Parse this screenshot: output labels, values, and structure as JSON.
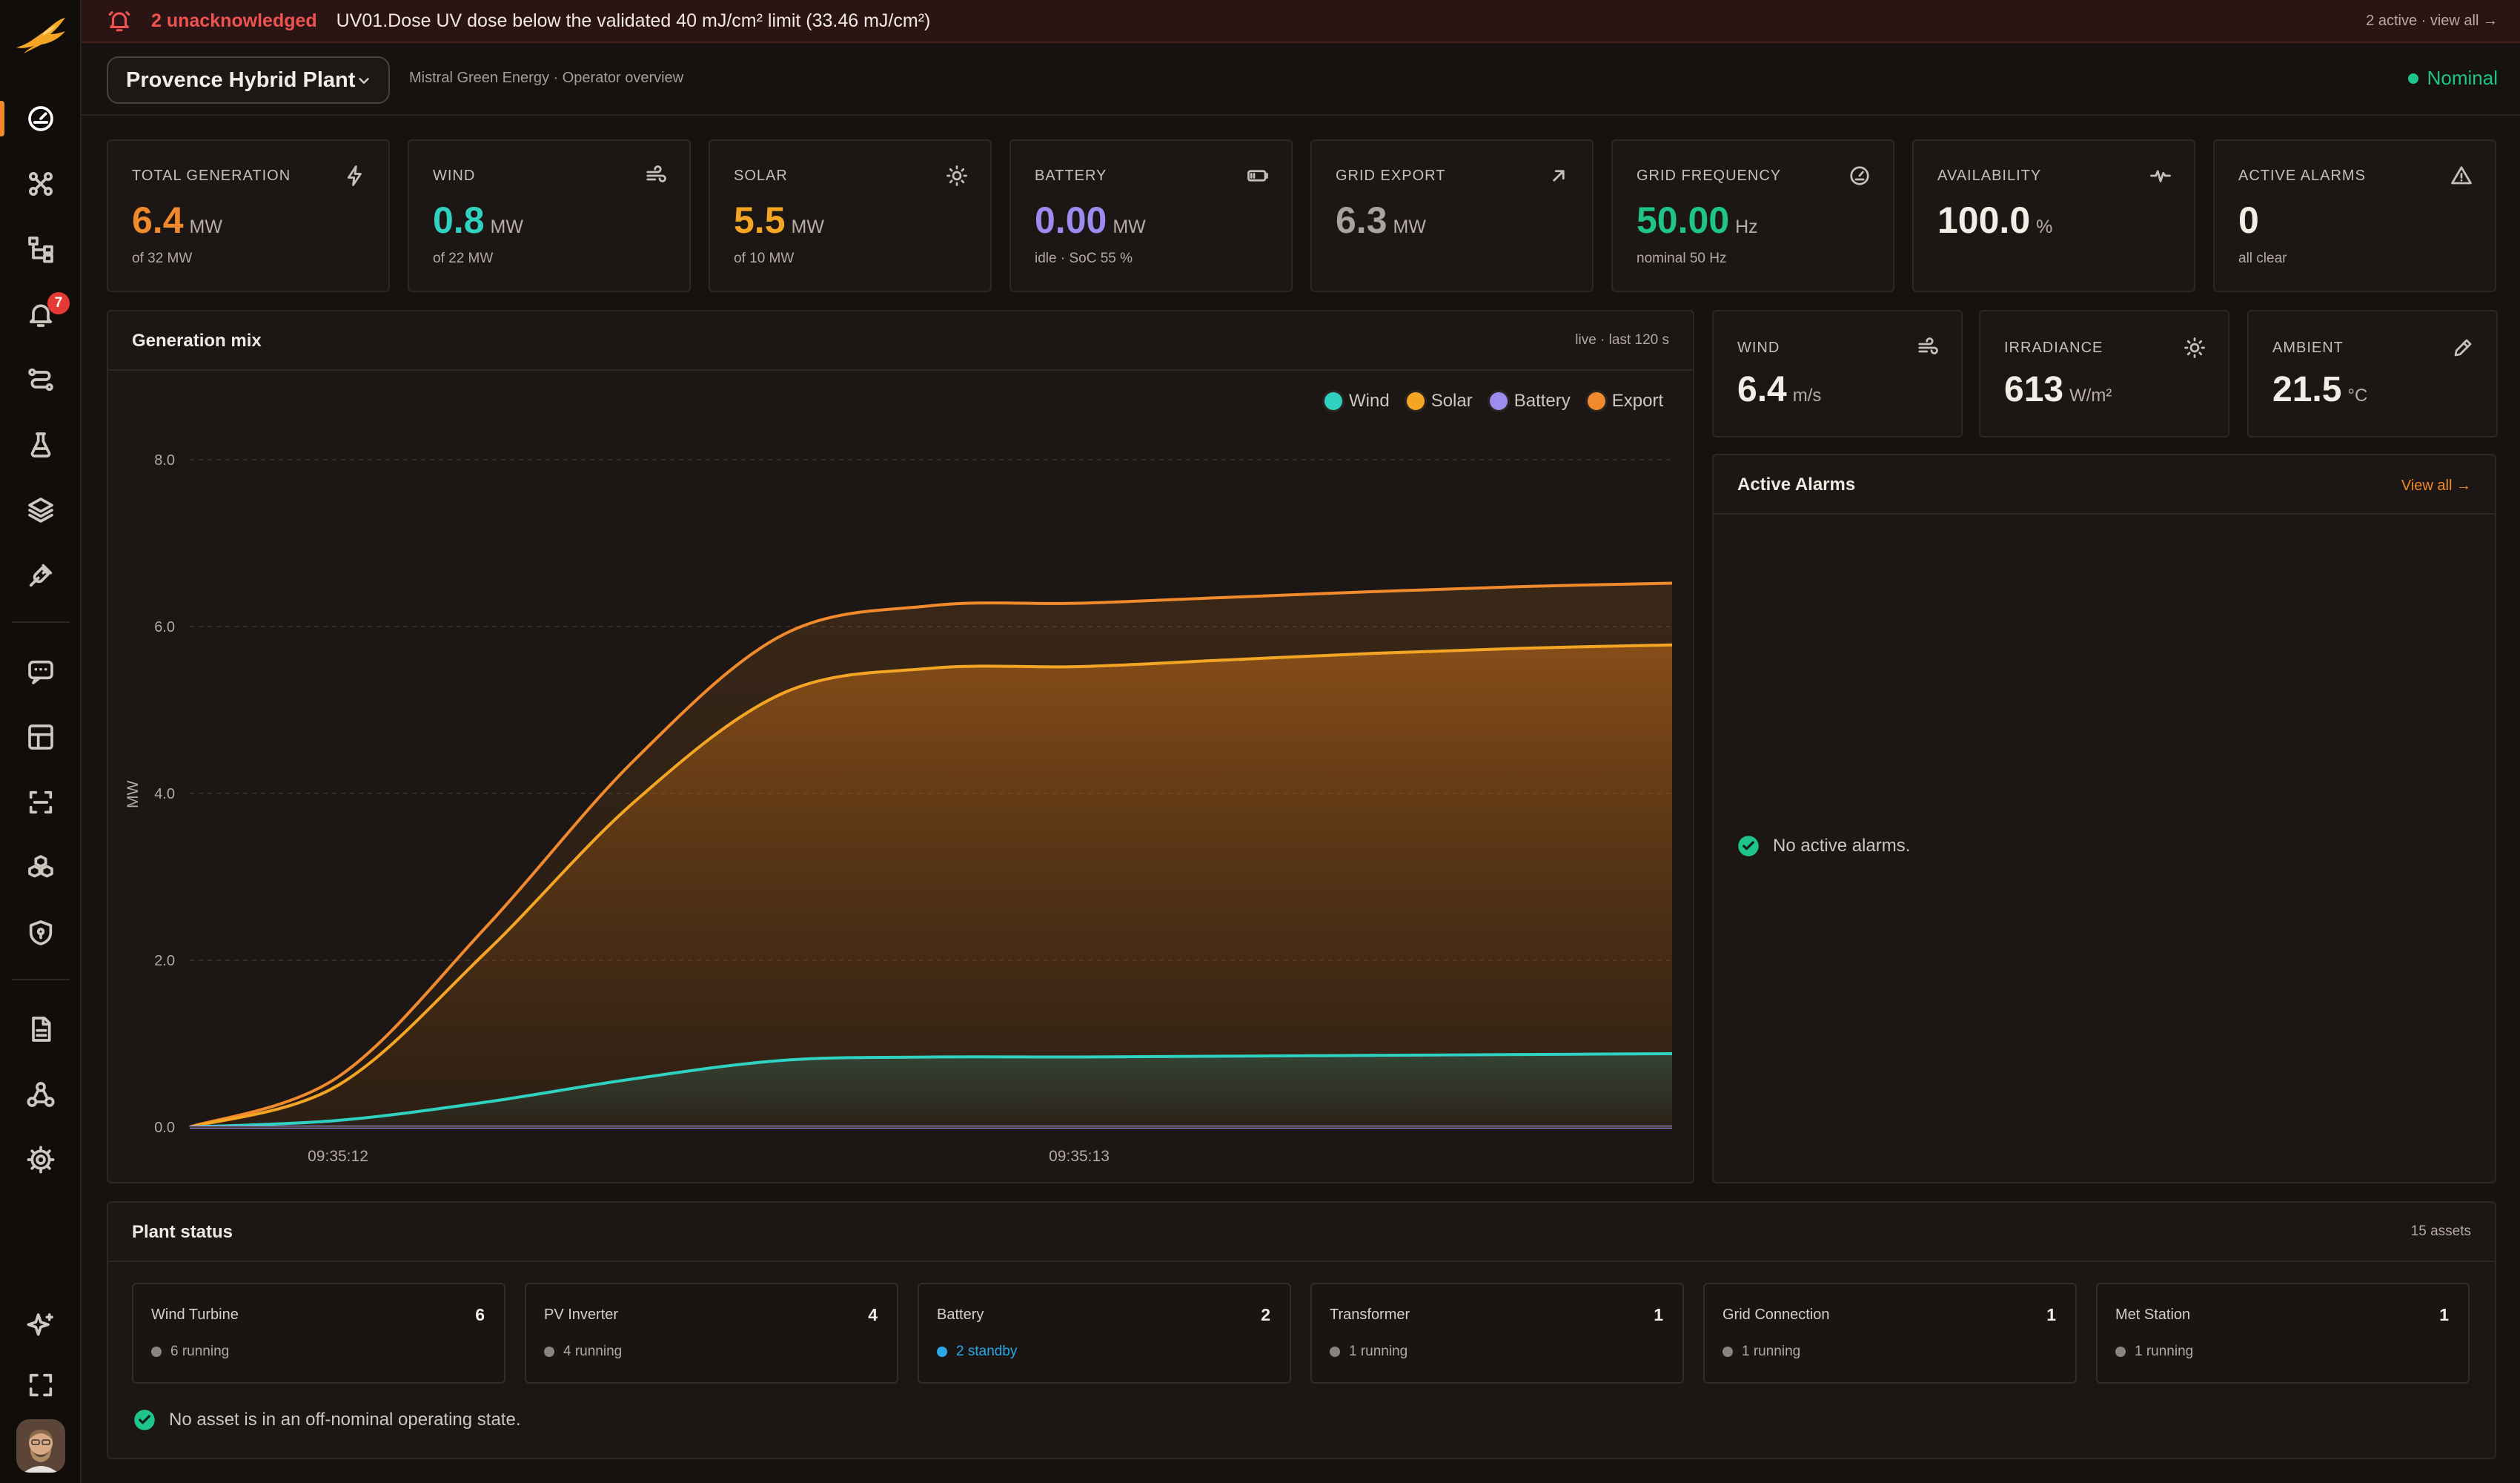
{
  "alert_bar": {
    "count_text": "2 unacknowledged",
    "message": "UV01.Dose UV dose below the validated 40 mJ/cm² limit (33.46 mJ/cm²)",
    "link": "2 active · view all →"
  },
  "sidebar": {
    "notification_badge": "7",
    "items": [
      "dashboard-icon",
      "network-icon",
      "hierarchy-icon",
      "bell-icon",
      "route-icon",
      "flask-icon",
      "layers-icon",
      "plug-icon",
      "chat-icon",
      "grid-icon",
      "scan-icon",
      "modules-icon",
      "shield-icon",
      "document-icon",
      "org-icon",
      "settings-icon",
      "sparkle-icon",
      "fullscreen-icon"
    ]
  },
  "header": {
    "plant_name": "Provence Hybrid Plant",
    "subtitle": "Mistral Green Energy · Operator overview",
    "status": "Nominal"
  },
  "kpis": [
    {
      "label": "TOTAL GENERATION",
      "value": "6.4",
      "unit": "MW",
      "sub": "of 32 MW",
      "color": "#f08a2c",
      "icon": "bolt-icon"
    },
    {
      "label": "WIND",
      "value": "0.8",
      "unit": "MW",
      "sub": "of 22 MW",
      "color": "#2fd1c0",
      "icon": "wind-icon"
    },
    {
      "label": "SOLAR",
      "value": "5.5",
      "unit": "MW",
      "sub": "of 10 MW",
      "color": "#f5a524",
      "icon": "sun-icon"
    },
    {
      "label": "BATTERY",
      "value": "0.00",
      "unit": "MW",
      "sub": "idle · SoC 55 %",
      "color": "#9d8cf0",
      "icon": "battery-icon"
    },
    {
      "label": "GRID EXPORT",
      "value": "6.3",
      "unit": "MW",
      "sub": "",
      "color": "#a8a2a0",
      "icon": "arrow-up-right-icon"
    },
    {
      "label": "GRID FREQUENCY",
      "value": "50.00",
      "unit": "Hz",
      "sub": "nominal 50 Hz",
      "color": "#1fc48a",
      "icon": "gauge-icon"
    },
    {
      "label": "AVAILABILITY",
      "value": "100.0",
      "unit": "%",
      "sub": "",
      "color": "#f3ede6",
      "icon": "pulse-icon"
    },
    {
      "label": "ACTIVE ALARMS",
      "value": "0",
      "unit": "",
      "sub": "all clear",
      "color": "#f3ede6",
      "icon": "warning-icon"
    }
  ],
  "generation_mix": {
    "title": "Generation mix",
    "live_label": "live · last 120 s"
  },
  "environment": [
    {
      "label": "WIND",
      "value": "6.4",
      "unit": "m/s",
      "icon": "wind-icon"
    },
    {
      "label": "IRRADIANCE",
      "value": "613",
      "unit": "W/m²",
      "icon": "sun-icon"
    },
    {
      "label": "AMBIENT",
      "value": "21.5",
      "unit": "°C",
      "icon": "thermometer-icon"
    }
  ],
  "alarms_panel": {
    "title": "Active Alarms",
    "view_all": "View all →",
    "empty_text": "No active alarms."
  },
  "plant_status": {
    "title": "Plant status",
    "asset_count": "15 assets",
    "assets": [
      {
        "name": "Wind Turbine",
        "count": "6",
        "state": "6 running",
        "state_color": "#8a8480"
      },
      {
        "name": "PV Inverter",
        "count": "4",
        "state": "4 running",
        "state_color": "#8a8480"
      },
      {
        "name": "Battery",
        "count": "2",
        "state": "2 standby",
        "state_color": "#29a8e8"
      },
      {
        "name": "Transformer",
        "count": "1",
        "state": "1 running",
        "state_color": "#8a8480"
      },
      {
        "name": "Grid Connection",
        "count": "1",
        "state": "1 running",
        "state_color": "#8a8480"
      },
      {
        "name": "Met Station",
        "count": "1",
        "state": "1 running",
        "state_color": "#8a8480"
      }
    ],
    "footer_text": "No asset is in an off-nominal operating state."
  },
  "chart_data": {
    "type": "area",
    "title": "Generation mix",
    "xlabel": "",
    "ylabel": "MW",
    "ylim": [
      0,
      8
    ],
    "yticks": [
      "0.0",
      "2.0",
      "4.0",
      "6.0",
      "8.0"
    ],
    "x_tick_labels": [
      "09:35:12",
      "09:35:13"
    ],
    "x": [
      0,
      10,
      20,
      30,
      40,
      50,
      60,
      70,
      80,
      90,
      100
    ],
    "legend_position": "top-right",
    "grid": true,
    "series": [
      {
        "name": "Wind",
        "color": "#2fd1c0",
        "values": [
          0,
          0.08,
          0.3,
          0.58,
          0.8,
          0.84,
          0.84,
          0.85,
          0.86,
          0.87,
          0.88
        ]
      },
      {
        "name": "Solar",
        "color": "#f5a524",
        "values": [
          0,
          0.5,
          2.1,
          3.9,
          5.2,
          5.5,
          5.52,
          5.6,
          5.68,
          5.74,
          5.78
        ]
      },
      {
        "name": "Battery",
        "color": "#9d8cf0",
        "values": [
          0,
          0,
          0,
          0,
          0,
          0,
          0,
          0,
          0,
          0,
          0
        ]
      },
      {
        "name": "Export",
        "color": "#f08a2c",
        "values": [
          0,
          0.6,
          2.4,
          4.4,
          5.9,
          6.25,
          6.28,
          6.35,
          6.42,
          6.48,
          6.52
        ]
      }
    ]
  }
}
